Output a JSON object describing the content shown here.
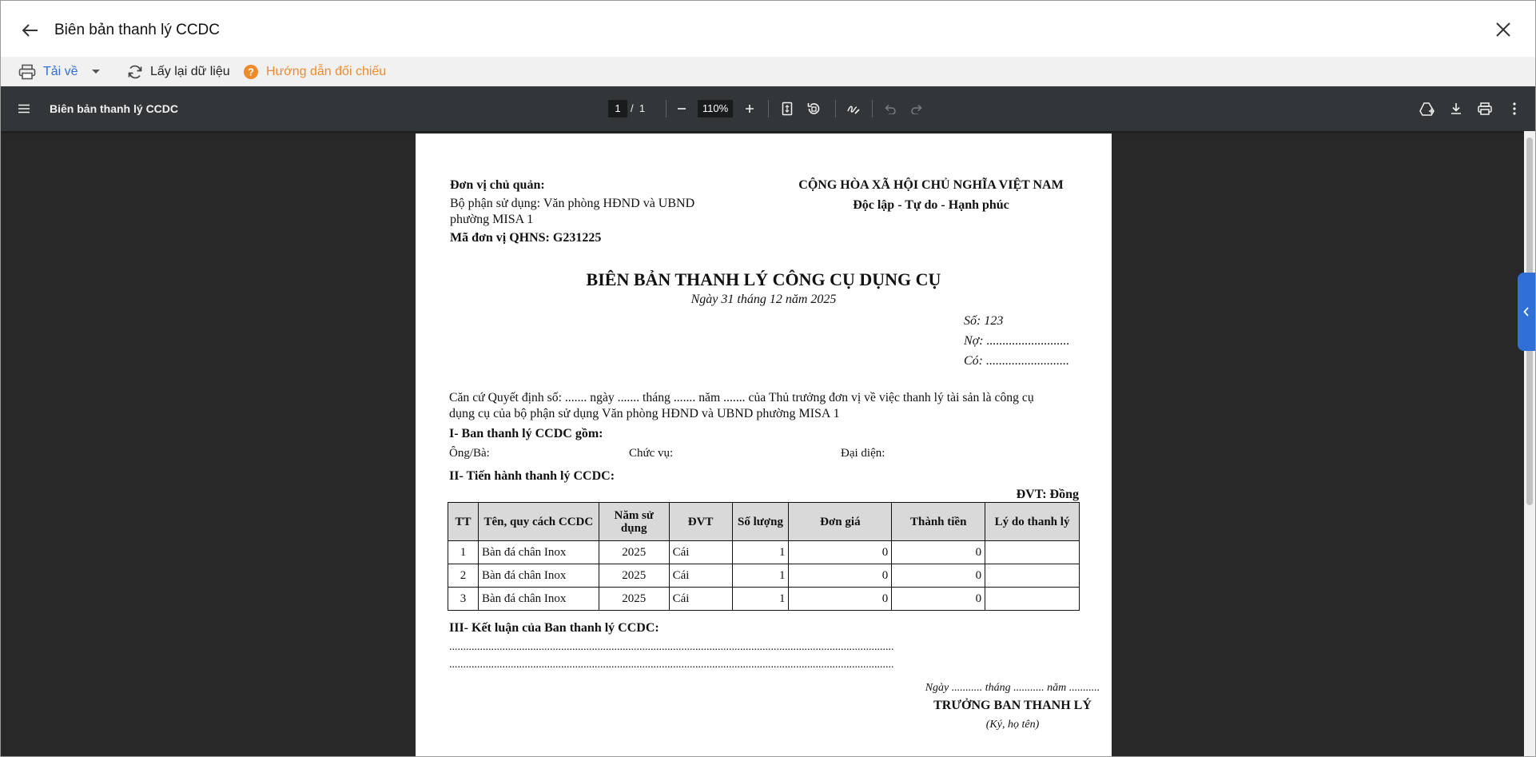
{
  "window": {
    "title": "Biên bản thanh lý CCDC"
  },
  "toolbar": {
    "download_label": "Tải về",
    "reload_label": "Lấy lại dữ liệu",
    "guide_label": "Hướng dẫn đối chiếu"
  },
  "viewer": {
    "doc_title": "Biên bản thanh lý CCDC",
    "current_page": "1",
    "page_separator": "/",
    "total_pages": "1",
    "zoom": "110%"
  },
  "document": {
    "unit_owner_label": "Đơn vị chủ quản:",
    "department_line1": "Bộ phận sử dụng: Văn phòng HĐND và UBND",
    "department_line2": "phường MISA 1",
    "budget_code": "Mã đơn vị QHNS: G231225",
    "nation": "CỘNG HÒA XÃ HỘI CHỦ NGHĨA VIỆT NAM",
    "motto": "Độc lập - Tự do - Hạnh phúc",
    "heading": "BIÊN BẢN THANH LÝ CÔNG CỤ DỤNG CỤ",
    "date": "Ngày 31 tháng 12 năm 2025",
    "number": "Số: 123",
    "debit": "Nợ: ..........................",
    "credit": "Có: ..........................",
    "basis_line1": "Căn cứ Quyết định số: ....... ngày ....... tháng ....... năm ....... của Thủ trưởng đơn vị về việc thanh lý tài sản là công cụ",
    "basis_line2": "dụng cụ của bộ phận sử dụng Văn phòng HĐND và UBND phường MISA 1",
    "section1": "I- Ban thanh lý CCDC gồm:",
    "member_name": "Ông/Bà:",
    "member_position": "Chức vụ:",
    "member_represent": "Đại diện:",
    "section2": "II- Tiến hành thanh lý CCDC:",
    "unit_note": "ĐVT: Đồng",
    "table_headers": [
      "TT",
      "Tên, quy cách CCDC",
      "Năm sử dụng",
      "ĐVT",
      "Số lượng",
      "Đơn giá",
      "Thành tiền",
      "Lý do thanh lý"
    ],
    "table_rows": [
      [
        "1",
        "Bàn đá chân Inox",
        "2025",
        "Cái",
        "1",
        "0",
        "0",
        ""
      ],
      [
        "2",
        "Bàn đá chân Inox",
        "2025",
        "Cái",
        "1",
        "0",
        "0",
        ""
      ],
      [
        "3",
        "Bàn đá chân Inox",
        "2025",
        "Cái",
        "1",
        "0",
        "0",
        ""
      ]
    ],
    "section3": "III- Kết luận của Ban thanh lý CCDC:",
    "dots_line": "...............................................................................................................................................................",
    "sign_date": "Ngày ........... tháng ........... năm ...........",
    "signer_title": "TRƯỞNG BAN THANH LÝ",
    "signer_note": "(Ký, họ tên)"
  },
  "colors": {
    "accent_blue": "#2f6fd6",
    "guide_orange": "#ef8a2a",
    "viewer_bar": "#323639",
    "viewer_bg": "#282828"
  },
  "icons": [
    "back-arrow-icon",
    "close-icon",
    "printer-icon",
    "chevron-down-icon",
    "refresh-icon",
    "help-circle-icon",
    "menu-icon",
    "minus-icon",
    "plus-icon",
    "fit-page-icon",
    "rotate-icon",
    "annotate-icon",
    "undo-icon",
    "redo-icon",
    "add-to-drive-icon",
    "download-icon",
    "print-icon",
    "more-vert-icon",
    "chevron-left-icon"
  ]
}
